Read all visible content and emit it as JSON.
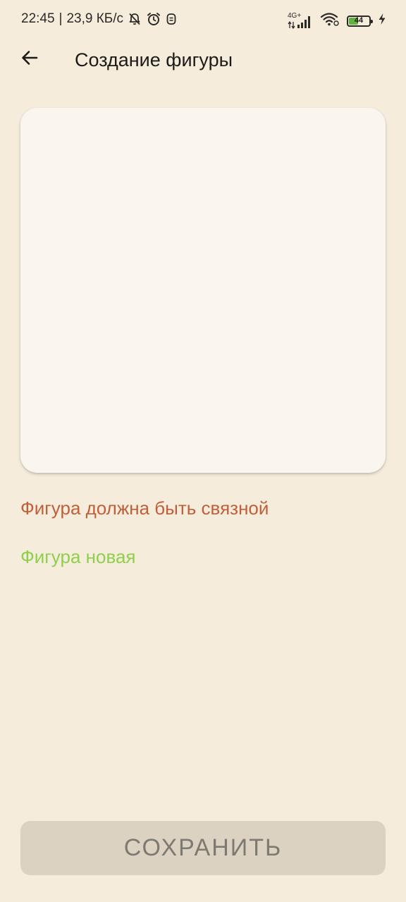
{
  "status_bar": {
    "time": "22:45",
    "separator": "|",
    "speed": "23,9 КБ/с",
    "network_type": "4G+",
    "battery_level": "44",
    "icons": [
      "bell-off-icon",
      "alarm-icon",
      "app-notification-icon",
      "signal-icon",
      "wifi-icon",
      "battery-icon",
      "charging-icon"
    ]
  },
  "app_bar": {
    "title": "Создание фигуры",
    "back_icon": "arrow-left-icon"
  },
  "messages": {
    "error": "Фигура должна быть связной",
    "status": "Фигура новая"
  },
  "save_button": {
    "label": "СОХРАНИТЬ",
    "enabled": false
  },
  "colors": {
    "background": "#f5ecdc",
    "canvas": "#faf5ef",
    "error_text": "#c0603a",
    "success_text": "#8ed04a",
    "button_disabled_bg": "#dcd2c1",
    "button_disabled_text": "#7d7a72"
  }
}
